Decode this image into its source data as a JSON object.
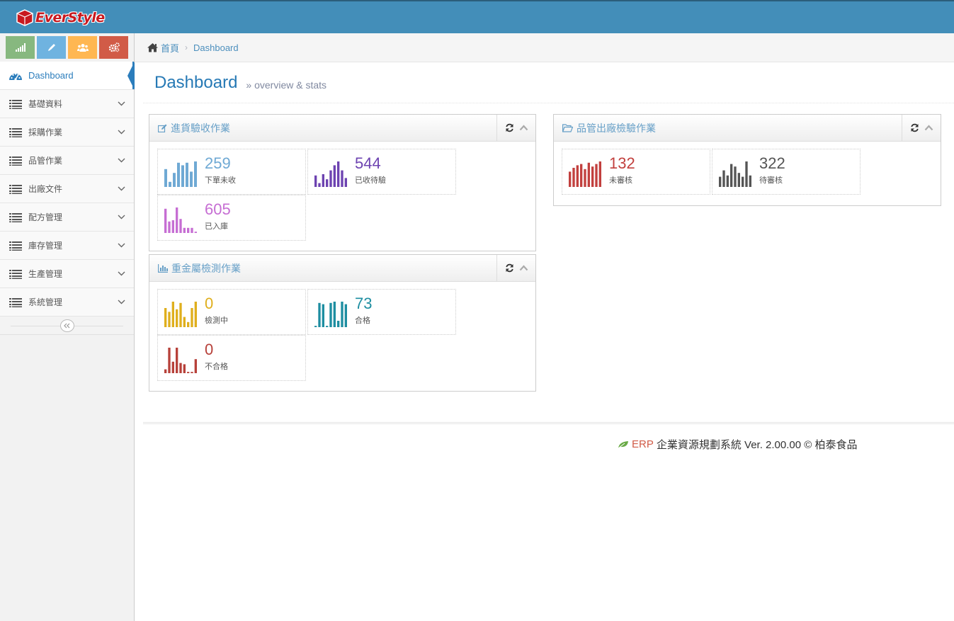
{
  "brand": {
    "name": "EverStyle"
  },
  "shortcuts": [
    {
      "icon": "signal-icon",
      "color": "#87b87f"
    },
    {
      "icon": "pencil-icon",
      "color": "#6fb3e0"
    },
    {
      "icon": "users-icon",
      "color": "#ffb752"
    },
    {
      "icon": "cogs-icon",
      "color": "#d15b47"
    }
  ],
  "sidebar": {
    "items": [
      {
        "label": "Dashboard",
        "icon": "dashboard-icon",
        "active": true
      },
      {
        "label": "基礎資料",
        "icon": "list-icon"
      },
      {
        "label": "採購作業",
        "icon": "list-icon"
      },
      {
        "label": "品管作業",
        "icon": "list-icon"
      },
      {
        "label": "出廠文件",
        "icon": "list-icon"
      },
      {
        "label": "配方管理",
        "icon": "list-icon"
      },
      {
        "label": "庫存管理",
        "icon": "list-icon"
      },
      {
        "label": "生產管理",
        "icon": "list-icon"
      },
      {
        "label": "系統管理",
        "icon": "list-icon"
      }
    ]
  },
  "breadcrumb": {
    "home": "首頁",
    "current": "Dashboard"
  },
  "page": {
    "title": "Dashboard",
    "subtitle": "» overview & stats"
  },
  "widgets": {
    "receiving": {
      "title": "進貨驗收作業",
      "stats": [
        {
          "value": "259",
          "label": "下單未收",
          "color": "#6fa9d4",
          "bars": [
            0.7,
            0.2,
            0.55,
            0.95,
            0.85,
            0.95,
            0.6,
            1.0
          ]
        },
        {
          "value": "544",
          "label": "已收待驗",
          "color": "#6d43b1",
          "bars": [
            0.45,
            0.15,
            0.5,
            0.3,
            0.65,
            0.85,
            1.0,
            0.65,
            0.35
          ]
        },
        {
          "value": "605",
          "label": "已入庫",
          "color": "#c66ed3",
          "bars": [
            0.95,
            0.45,
            0.5,
            1.0,
            0.55,
            0.2,
            0.2,
            0.2,
            0.05
          ]
        }
      ]
    },
    "heavy_metal": {
      "title": "重金屬檢測作業",
      "stats": [
        {
          "value": "0",
          "label": "檢測中",
          "color": "#dfaf1d",
          "bars": [
            0.75,
            0.6,
            1.0,
            0.7,
            0.95,
            0.4,
            0.2,
            0.75,
            1.0
          ]
        },
        {
          "value": "73",
          "label": "合格",
          "color": "#1e8ea1",
          "bars": [
            0.05,
            0.95,
            0.9,
            0.05,
            0.95,
            1.0,
            0.25,
            1.0,
            0.9
          ]
        },
        {
          "value": "0",
          "label": "不合格",
          "color": "#b7413a",
          "bars": [
            0.15,
            1.0,
            0.45,
            1.0,
            0.4,
            0.35,
            0.05,
            0.05,
            0.55
          ]
        }
      ]
    },
    "outgoing_qc": {
      "title": "品管出廠檢驗作業",
      "stats": [
        {
          "value": "132",
          "label": "未審核",
          "color": "#c2403e",
          "bars": [
            0.6,
            0.75,
            0.85,
            0.9,
            0.7,
            0.95,
            0.8,
            0.9,
            1.0
          ]
        },
        {
          "value": "322",
          "label": "待審核",
          "color": "#555555",
          "bars": [
            0.4,
            0.65,
            0.45,
            0.9,
            0.8,
            0.55,
            0.4,
            1.0,
            0.45
          ]
        }
      ]
    }
  },
  "footer": {
    "erp": "ERP",
    "text": "企業資源規劃系統 Ver. 2.00.00 © 柏泰食品"
  }
}
